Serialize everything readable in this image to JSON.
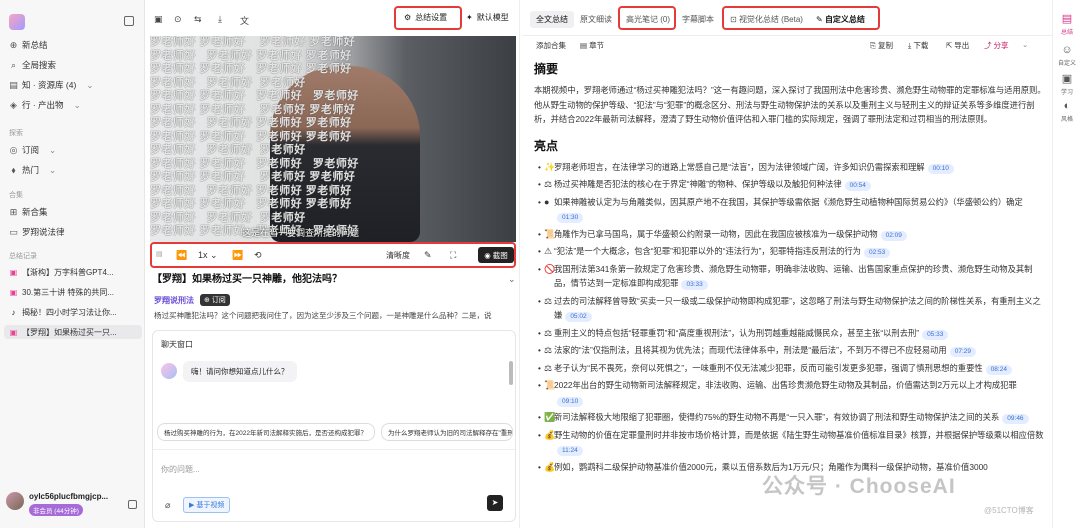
{
  "sidebar": {
    "nav": [
      {
        "icon": "plus-icon",
        "label": "新总结"
      },
      {
        "icon": "search-icon",
        "label": "全局搜索"
      },
      {
        "icon": "book-icon",
        "label": "知 · 资源库 (4)"
      },
      {
        "icon": "box-icon",
        "label": "行 · 产出物"
      }
    ],
    "explore_title": "探索",
    "explore": [
      {
        "label": "订阅"
      },
      {
        "label": "热门"
      }
    ],
    "collections_title": "合集",
    "collections": [
      {
        "label": "新合集"
      },
      {
        "label": "罗翔说法律"
      }
    ],
    "history_title": "总结记录",
    "history": [
      {
        "label": "【渐构】万字科普GPT4..."
      },
      {
        "label": "30.第三十讲 特殊的共同..."
      },
      {
        "label": "揭秘！四小时学习法让你..."
      },
      {
        "label": "【罗翔】如果杨过买一只..."
      }
    ],
    "user": {
      "name": "oylc56plucfbmgjcp...",
      "tier": "非会员 (44分钟)"
    }
  },
  "toolbar": {
    "summary_settings": "总结设置",
    "default_model": "默认模型"
  },
  "video": {
    "watermark": "罗老师好",
    "subtitle": "这是在当一要调查所提的问题",
    "speed": "1x",
    "clarity": "清晰度",
    "screenshot": "截图",
    "title": "【罗翔】如果杨过买一只神雕，他犯法吗？",
    "channel": "罗翔说刑法",
    "subscribe": "订阅",
    "description": "杨过买神雕犯法吗？这个问题把我问住了，因为这至少涉及三个问题，一是神雕是什么品种？二是，说"
  },
  "chat": {
    "header": "聊天窗口",
    "greeting": "嗨！请问你想知道点儿什么？",
    "suggestions": [
      "杨过购买神雕的行为，在2022年新司法解释实施后，是否还构成犯罪？",
      "为什么罗翔老师认为旧的司法解释存在\"重刑"
    ],
    "placeholder": "你的问题...",
    "video_button": "基于视频"
  },
  "tabs": {
    "full_summary": "全文总结",
    "original": "原文细读",
    "highlights": "高光笔记 (0)",
    "transcript": "字幕脚本",
    "visual": "视觉化总结 (Beta)",
    "custom": "自定义总结"
  },
  "tools": {
    "add_collection": "添加合集",
    "chapter": "章节",
    "copy": "复制",
    "download": "下载",
    "export": "导出",
    "share": "分享"
  },
  "summary": {
    "abstract_title": "摘要",
    "abstract": "本期视频中，罗翔老师通过“杨过买神雕犯法吗？”这一有趣问题，深入探讨了我国刑法中危害珍贵、濒危野生动物罪的定罪标准与适用原则。他从野生动物的保护等级、“犯法”与“犯罪”的概念区分、刑法与野生动物保护法的关系以及重刑主义与轻刑主义的辩证关系等多维度进行剖析，并结合2022年最新司法解释，澄清了野生动物价值评估和入罪门槛的实际规定，强调了罪刑法定和过罚相当的刑法原则。",
    "highlights_title": "亮点",
    "highlights": [
      {
        "emoji": "✨",
        "text": "罗翔老师坦言，在法律学习的道路上常感自己是“法盲”，因为法律领域广阔，许多知识仍需探索和理解",
        "ts": "00:10"
      },
      {
        "emoji": "⚖",
        "text": "杨过买神雕是否犯法的核心在于界定“神雕”的物种、保护等级以及触犯何种法律",
        "ts": "00:54"
      },
      {
        "emoji": "●",
        "text": "如果神雕被认定为与角雕类似，因其原产地不在我国，其保护等级需依据《濒危野生动植物种国际贸易公约》（华盛顿公约）确定",
        "ts": "01:30"
      },
      {
        "emoji": "📜",
        "text": "角雕作为已拿马国鸟，属于华盛顿公约附录一动物，因此在我国应被核准为一级保护动物",
        "ts": "02:09"
      },
      {
        "emoji": "⚠",
        "text": "“犯法”是一个大概念，包含“犯罪”和犯罪以外的“违法行为”，犯罪特指违反刑法的行为",
        "ts": "02:53"
      },
      {
        "emoji": "🚫",
        "text": "我国刑法第341条第一款规定了危害珍贵、濒危野生动物罪，明确非法收购、运输、出售国家重点保护的珍贵、濒危野生动物及其制品，情节达到一定标准即构成犯罪",
        "ts": "03:33"
      },
      {
        "emoji": "⚖",
        "text": "过去的司法解释曾导致“买卖一只一级或二级保护动物即构成犯罪”，这忽略了刑法与野生动物保护法之间的阶梯性关系，有重刑主义之嫌",
        "ts": "05:02"
      },
      {
        "emoji": "⚖",
        "text": "重刑主义的特点包括“轻罪重罚”和“高度重视刑法”，认为刑罚越重越能威慑民众，甚至主张“以刑去刑”",
        "ts": "05:33"
      },
      {
        "emoji": "⚖",
        "text": "法家的“法”仅指刑法，且将其视为优先法；而现代法律体系中，刑法是“最后法”，不到万不得已不应轻易动用",
        "ts": "07:29"
      },
      {
        "emoji": "⚖",
        "text": "老子认为“民不畏死，奈何以死惧之”，一味重刑不仅无法减少犯罪，反而可能引发更多犯罪，强调了慎刑思想的重要性",
        "ts": "08:24"
      },
      {
        "emoji": "📜",
        "text": "2022年出台的野生动物新司法解释规定，非法收购、运输、出售珍贵濒危野生动物及其制品，价值需达到2万元以上才构成犯罪",
        "ts": "09:10"
      },
      {
        "emoji": "✅",
        "text": "新司法解释极大地限缩了犯罪圈，使得约75%的野生动物不再是“一只入罪”，有效协调了刑法和野生动物保护法之间的关系",
        "ts": "09:46"
      },
      {
        "emoji": "💰",
        "text": "野生动物的价值在定罪量刑时并非按市场价格计算，而是依据《陆生野生动物基准价值标准目录》核算，并根据保护等级乘以相应倍数",
        "ts": "11:24"
      },
      {
        "emoji": "💰",
        "text": "例如，鹦鹉科二级保护动物基准价值2000元，乘以五倍系数后为1万元/只；角雕作为鹰科一级保护动物，基准价值3000",
        "ts": ""
      }
    ]
  },
  "rail": [
    {
      "label": "总结",
      "icon": "doc-icon"
    },
    {
      "label": "自定义",
      "icon": "user-icon"
    },
    {
      "label": "学习",
      "icon": "book-icon"
    },
    {
      "label": "风格",
      "icon": "palette-icon"
    }
  ],
  "watermark": {
    "text": "公众号 · ChooseAI",
    "small": "@51CTO博客"
  }
}
